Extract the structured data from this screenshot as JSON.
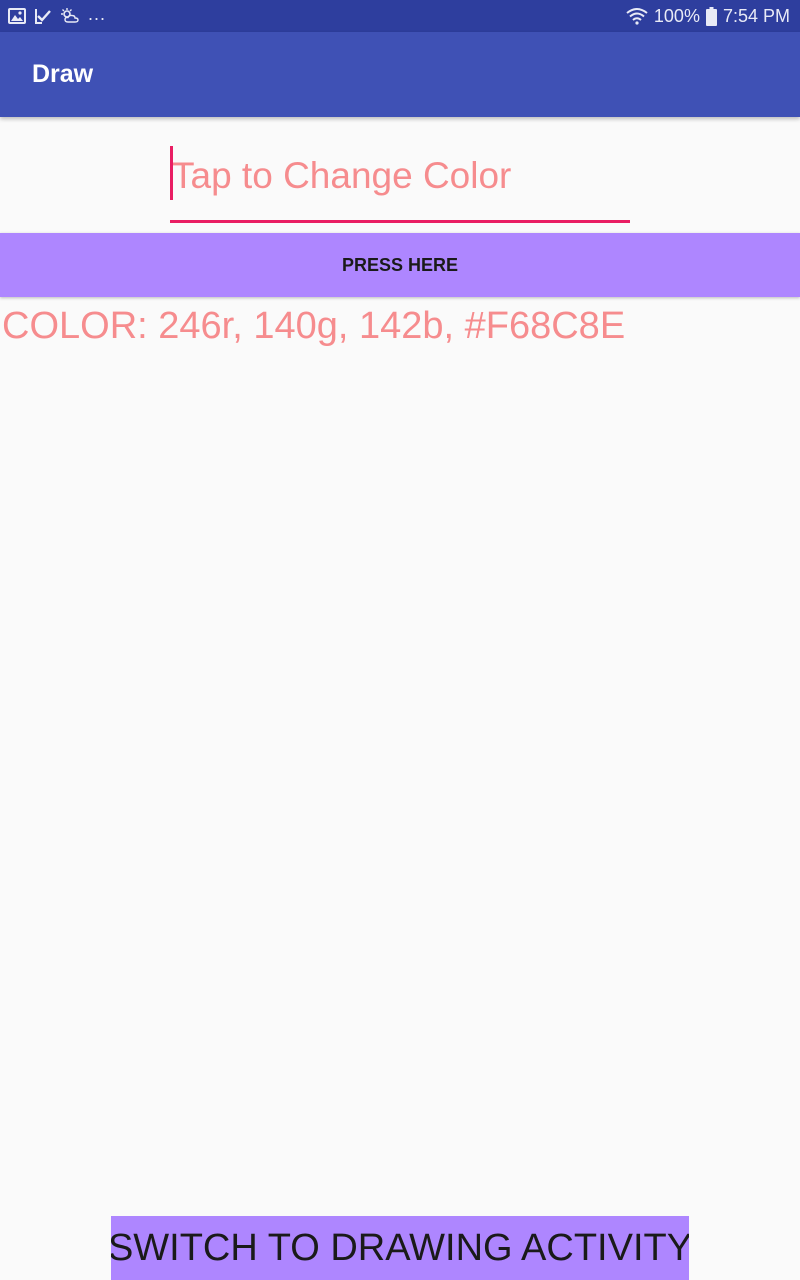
{
  "status_bar": {
    "left_icons": [
      "gallery-icon",
      "download-check-icon",
      "weather-icon"
    ],
    "more_indicator": "...",
    "battery_percent": "100%",
    "time": "7:54 PM",
    "right_icons": [
      "wifi-icon",
      "battery-icon"
    ]
  },
  "app_bar": {
    "title": "Draw"
  },
  "color_input": {
    "value": "",
    "placeholder": "Tap to Change Color"
  },
  "press_button": {
    "label": "PRESS HERE"
  },
  "color_readout": {
    "text": "COLOR: 246r, 140g, 142b, #F68C8E"
  },
  "switch_button": {
    "label": "SWITCH TO DRAWING ACTIVITY"
  },
  "colors": {
    "status_bar": "#2e3e9e",
    "app_bar": "#3f51b5",
    "accent": "#e91e63",
    "button": "#ae86ff",
    "selected_color": "#F68C8E",
    "background": "#fafafa"
  }
}
